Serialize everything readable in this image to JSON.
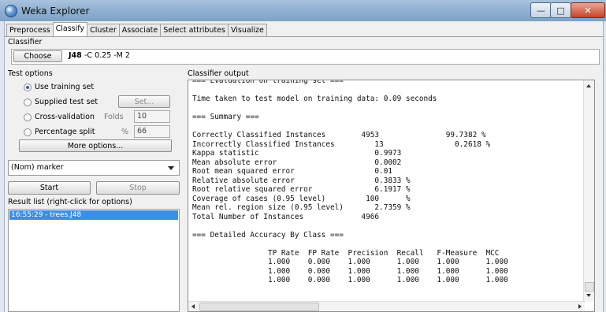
{
  "window": {
    "title": "Weka Explorer",
    "controls": [
      "minimize",
      "maximize",
      "close"
    ]
  },
  "tabs": [
    "Preprocess",
    "Classify",
    "Cluster",
    "Associate",
    "Select attributes",
    "Visualize"
  ],
  "active_tab": "Classify",
  "classifier": {
    "section_label": "Classifier",
    "choose_label": "Choose",
    "name": "J48",
    "options": "-C 0.25 -M 2"
  },
  "test_options": {
    "label": "Test options",
    "use_training_set": "Use training set",
    "supplied_test_set": "Supplied test set",
    "set_button": "Set...",
    "cross_validation": "Cross-validation",
    "folds_label": "Folds",
    "folds_value": "10",
    "percentage_split": "Percentage split",
    "percent_symbol": "%",
    "percent_value": "66",
    "more_options": "More options...",
    "selected": "use_training_set"
  },
  "class_attribute": "(Nom) marker",
  "start_label": "Start",
  "stop_label": "Stop",
  "result_list": {
    "label": "Result list (right-click for options)",
    "items": [
      "16:55:29 - trees.J48"
    ]
  },
  "output": {
    "label": "Classifier output",
    "lines": [
      "=== Evaluation on training set ===",
      "",
      "Time taken to test model on training data: 0.09 seconds",
      "",
      "=== Summary ===",
      "",
      "Correctly Classified Instances        4953               99.7382 %",
      "Incorrectly Classified Instances         13                0.2618 %",
      "Kappa statistic                          0.9973",
      "Mean absolute error                      0.0002",
      "Root mean squared error                  0.01",
      "Relative absolute error                  0.3833 %",
      "Root relative squared error              6.1917 %",
      "Coverage of cases (0.95 level)         100      %",
      "Mean rel. region size (0.95 level)       2.7359 %",
      "Total Number of Instances             4966",
      "",
      "=== Detailed Accuracy By Class ===",
      "",
      "                 TP Rate  FP Rate  Precision  Recall   F-Measure  MCC",
      "                 1.000    0.000    1.000      1.000    1.000      1.000",
      "                 1.000    0.000    1.000      1.000    1.000      1.000",
      "                 1.000    0.000    1.000      1.000    1.000      1.000"
    ]
  }
}
